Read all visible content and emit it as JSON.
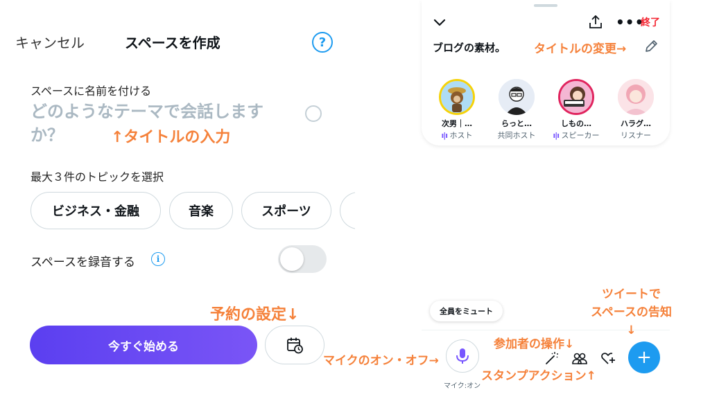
{
  "left": {
    "cancel": "キャンセル",
    "title": "スペースを作成",
    "help": "?",
    "name_label": "スペースに名前を付ける",
    "name_placeholder": "どのようなテーマで会話しますか？",
    "topic_label": "最大３件のトピックを選択",
    "topics": [
      "ビジネス・金融",
      "音楽",
      "スポーツ",
      ""
    ],
    "record_label": "スペースを録音する",
    "record_enabled": false,
    "info_icon": "i",
    "start_label": "今すぐ始める",
    "schedule_icon": "calendar-clock-icon"
  },
  "annotations": {
    "title_input": "↑タイトルの入力",
    "schedule": "予約の設定↓",
    "title_change": "タイトルの変更→",
    "tweet_line1": "ツイートで",
    "tweet_line2": "スペースの告知",
    "tweet_arrow": "↓",
    "participant_ops": "参加者の操作↓",
    "mic_toggle": "マイクのオン・オフ→",
    "stamp_action": "スタンプアクション↑"
  },
  "space": {
    "end_label": "終了",
    "title": "ブログの素材。",
    "participants": [
      {
        "name": "次男｜…",
        "role": "ホスト",
        "speaking": true,
        "ring": "#f5d20a"
      },
      {
        "name": "らっと…",
        "role": "共同ホスト",
        "speaking": false,
        "ring": ""
      },
      {
        "name": "しもの…",
        "role": "スピーカー",
        "speaking": true,
        "ring": "#e0245e"
      },
      {
        "name": "ハラグ…",
        "role": "リスナー",
        "speaking": false,
        "ring": ""
      }
    ],
    "speaking_indicator": "ı|ı",
    "mute_all": "全員をミュート",
    "mic_label": "マイク:オン",
    "compose": "+"
  },
  "colors": {
    "accent": "#1d9bf0",
    "annotation": "#f5813a",
    "start_gradient": [
      "#5b3ff0",
      "#7a55f6"
    ],
    "danger": "#f4212e",
    "mic": "#7856ff"
  }
}
